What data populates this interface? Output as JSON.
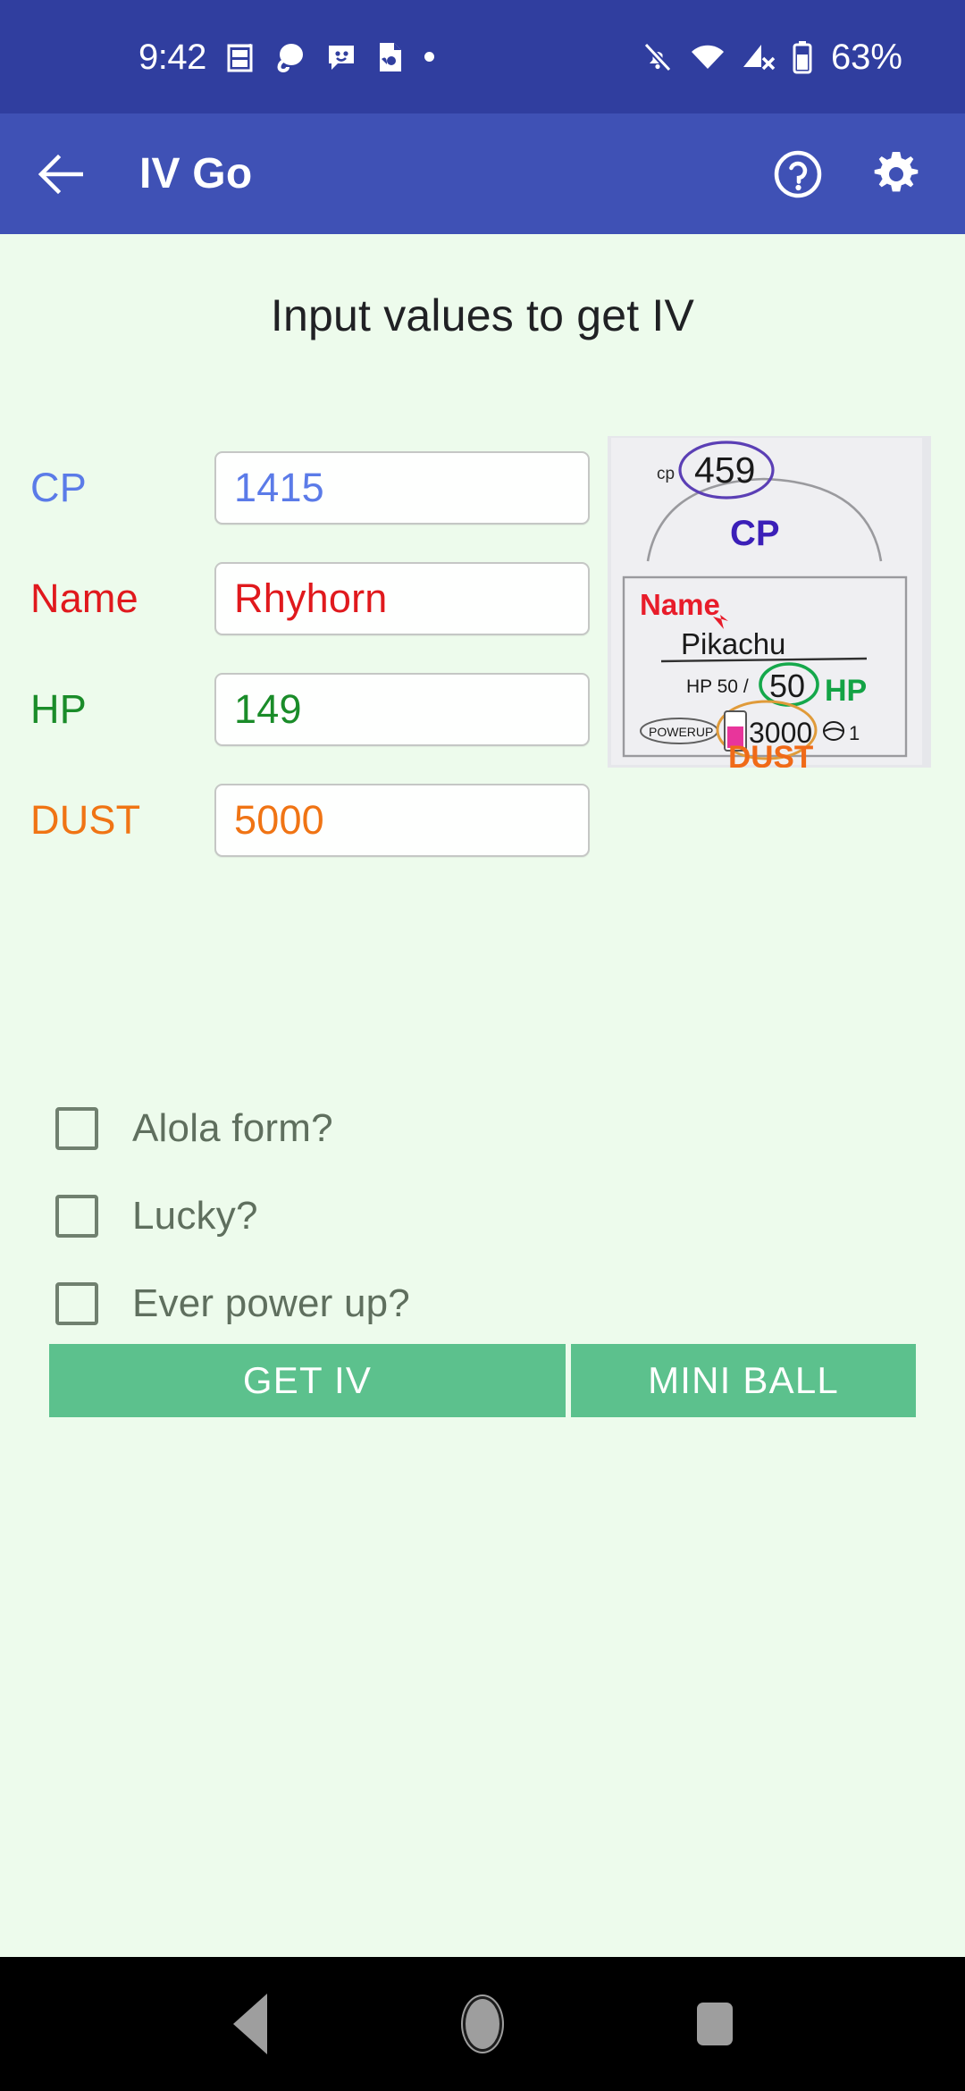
{
  "status_bar": {
    "time": "9:42",
    "battery_percent": "63%",
    "left_icons": [
      "app-notification-icon",
      "phone-bubble-icon",
      "messages-icon",
      "document-icon",
      "more-notifications-dot-icon"
    ],
    "right_icons": [
      "alarm-off-icon",
      "wifi-icon",
      "cellular-signal-off-icon",
      "battery-icon"
    ],
    "background_color": "#303E9F"
  },
  "app_bar": {
    "back_icon": "arrow-left-icon",
    "title": "IV Go",
    "help_icon": "help-circle-icon",
    "settings_icon": "gear-icon",
    "background_color": "#3F51B5"
  },
  "main": {
    "heading": "Input values to get IV",
    "background_color": "#EDFBEC",
    "fields": [
      {
        "id": "cp",
        "label": "CP",
        "value": "1415",
        "placeholder": "CP",
        "color": "#5B7BE8"
      },
      {
        "id": "name",
        "label": "Name",
        "value": "Rhyhorn",
        "placeholder": "Name",
        "color": "#E0191D"
      },
      {
        "id": "hp",
        "label": "HP",
        "value": "149",
        "placeholder": "HP",
        "color": "#1A8C29"
      },
      {
        "id": "dust",
        "label": "DUST",
        "value": "5000",
        "placeholder": "DUST",
        "color": "#F07414"
      }
    ],
    "reference_image": {
      "cp_small_label": "cp",
      "cp_number": "459",
      "cp_big_label": "CP",
      "name_label": "Name",
      "pokemon_name": "Pikachu",
      "hp_prefix": "HP 50 /",
      "hp_circled": "50",
      "hp_label": "HP",
      "powerup_label": "POWERUP",
      "dust_number": "3000",
      "candy_count": "1",
      "dust_label": "DUST"
    },
    "checkboxes": [
      {
        "id": "alola",
        "label": "Alola form?",
        "checked": false
      },
      {
        "id": "lucky",
        "label": "Lucky?",
        "checked": false
      },
      {
        "id": "powerup",
        "label": "Ever power up?",
        "checked": false
      }
    ],
    "buttons": [
      {
        "id": "get-iv",
        "label": "GET IV",
        "color": "#5CC18D"
      },
      {
        "id": "mini-ball",
        "label": "MINI BALL",
        "color": "#5CC18D"
      }
    ]
  },
  "nav_bar": {
    "back_icon": "nav-back-triangle-icon",
    "home_icon": "nav-home-circle-icon",
    "recents_icon": "nav-recents-square-icon",
    "background_color": "#000000"
  }
}
